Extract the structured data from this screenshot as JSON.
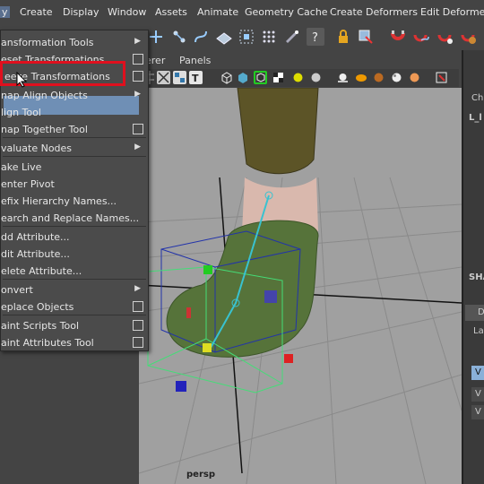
{
  "menubar": {
    "items": [
      "y",
      "Create",
      "Display",
      "Window",
      "Assets",
      "Animate",
      "Geometry Cache",
      "Create Deformers",
      "Edit Deformers"
    ],
    "active_index": 0
  },
  "panel_menu": {
    "items": [
      "erer",
      "Panels"
    ]
  },
  "right_panel": {
    "channel_label": "Cha",
    "object_label": "L_l",
    "shape_label": "SHA",
    "display_label": "D",
    "layers_label": "La",
    "rows": [
      "V",
      "V",
      "V"
    ]
  },
  "dropdown": {
    "items": [
      {
        "label": "ansformation Tools",
        "kind": "submenu"
      },
      {
        "label": "eset Transformations",
        "kind": "option"
      },
      {
        "label": "eeze Transformations",
        "kind": "option",
        "highlighted": true
      },
      {
        "label": "nap Align Objects",
        "kind": "submenu"
      },
      {
        "label": "lign Tool",
        "kind": "plain"
      },
      {
        "label": "nap Together Tool",
        "kind": "option"
      },
      {
        "label": "valuate Nodes",
        "kind": "submenu"
      },
      {
        "label": "ake Live",
        "kind": "plain"
      },
      {
        "label": "enter Pivot",
        "kind": "plain"
      },
      {
        "label": "efix Hierarchy Names...",
        "kind": "plain"
      },
      {
        "label": "earch and Replace Names...",
        "kind": "plain"
      },
      {
        "label": "dd Attribute...",
        "kind": "plain"
      },
      {
        "label": "dit Attribute...",
        "kind": "plain"
      },
      {
        "label": "elete Attribute...",
        "kind": "plain"
      },
      {
        "label": "onvert",
        "kind": "submenu"
      },
      {
        "label": "eplace Objects",
        "kind": "option"
      },
      {
        "label": "aint Scripts Tool",
        "kind": "option"
      },
      {
        "label": "aint Attributes Tool",
        "kind": "option"
      }
    ]
  },
  "viewport": {
    "camera_label": "persp"
  },
  "colors": {
    "highlight": "#6f8fb5",
    "annotation_red": "#e0101e",
    "menu_bg": "#4b4b4b",
    "viewport_bg": "#a0a0a0"
  }
}
